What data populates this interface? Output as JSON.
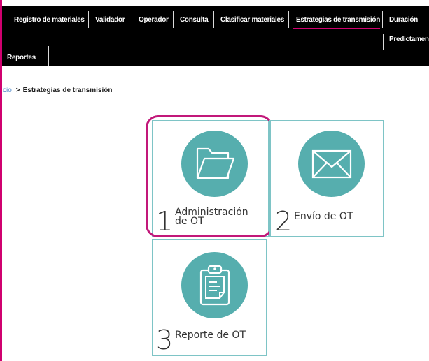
{
  "nav": {
    "items": [
      {
        "label": "Registro de materiales"
      },
      {
        "label": "Validador"
      },
      {
        "label": "Operador"
      },
      {
        "label": "Consulta"
      },
      {
        "label": "Clasificar materiales"
      },
      {
        "label": "Estrategias de transmisión",
        "active": true
      },
      {
        "label": "Duración"
      },
      {
        "label": "Predictamen"
      },
      {
        "label": "Reportes"
      }
    ]
  },
  "breadcrumb": {
    "home": "cio",
    "separator": ">",
    "current": "Estrategias de transmisión"
  },
  "tiles": [
    {
      "number": "1",
      "label": "Administración de OT",
      "icon": "folder-icon"
    },
    {
      "number": "2",
      "label": "Envío de OT",
      "icon": "envelope-icon"
    },
    {
      "number": "3",
      "label": "Reporte de OT",
      "icon": "clipboard-icon"
    }
  ],
  "colors": {
    "accent": "#d0006f",
    "tile_border": "#7ec4c6",
    "icon_circle": "#56aeae",
    "navbar": "#000000"
  }
}
